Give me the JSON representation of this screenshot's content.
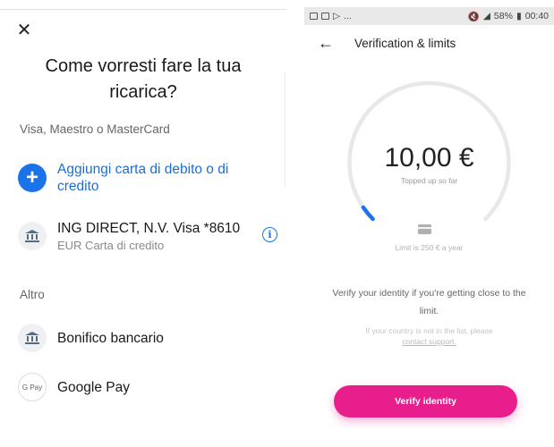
{
  "left": {
    "close_icon": "close-icon",
    "headline": "Come vorresti fare la tua ricarica?",
    "section_cards": "Visa, Maestro o MasterCard",
    "add_card": {
      "icon": "plus-icon",
      "label": "Aggiungi carta di debito o di credito"
    },
    "saved_card": {
      "icon": "bank-icon",
      "title": "ING DIRECT, N.V. Visa *8610",
      "subtitle": "EUR Carta di credito",
      "info_icon": "info-icon"
    },
    "section_other": "Altro",
    "bank_transfer": {
      "icon": "bank-icon",
      "label": "Bonifico bancario"
    },
    "google_pay": {
      "icon": "google-pay-icon",
      "badge": "G Pay",
      "label": "Google Pay"
    }
  },
  "right": {
    "statusbar": {
      "left": "...",
      "battery": "58%",
      "time": "00:40"
    },
    "title": "Verification & limits",
    "back_icon": "arrow-left-icon",
    "amount": "10,00 €",
    "amount_caption": "Topped up so far",
    "card_icon": "card-icon",
    "limit": "Limit is 250 € a year",
    "verify_message": "Verify your identity if you're getting close to the limit.",
    "note_prefix": "If your country is not in the list, please",
    "note_link": "contact support.",
    "verify_button": "Verify identity",
    "progress_fraction": 0.04,
    "colors": {
      "accent": "#e81e8c",
      "progress": "#1a73e8",
      "track": "#e8e8e8"
    }
  }
}
